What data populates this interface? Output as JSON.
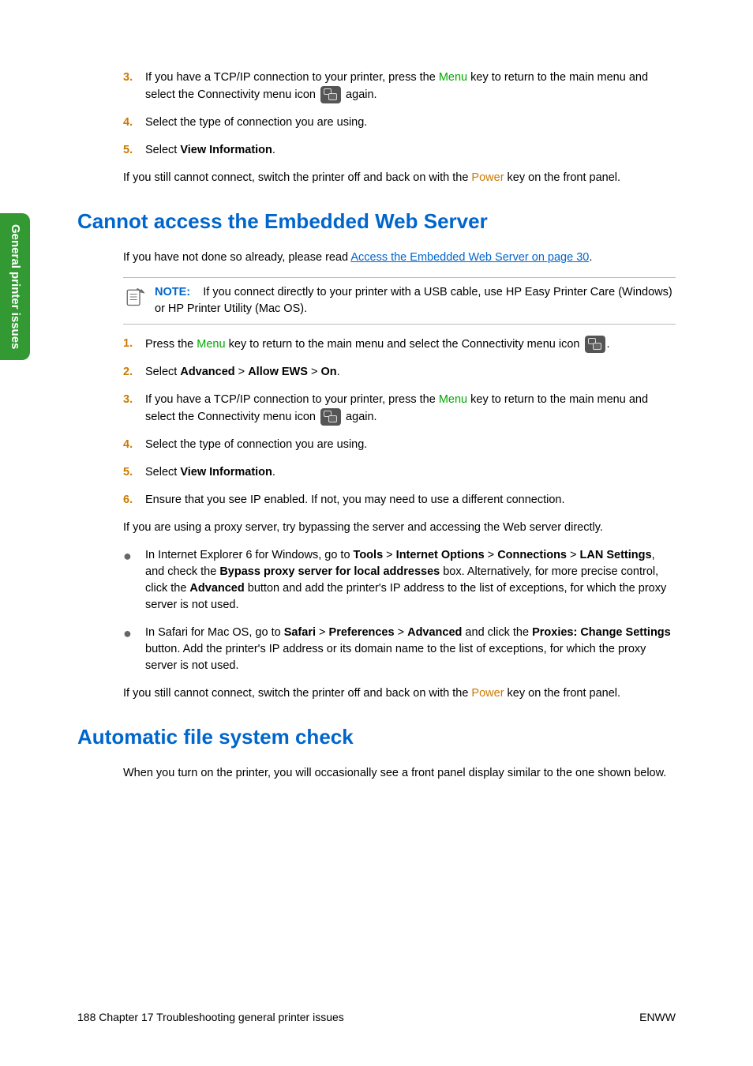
{
  "tab": {
    "label": "General printer issues"
  },
  "top_section": {
    "items": {
      "3": {
        "text1": "If you have a TCP/IP connection to your printer, press the ",
        "menu": "Menu",
        "text2": " key to return to the main menu and select the Connectivity menu icon ",
        "text3": " again."
      },
      "4": "Select the type of connection you are using.",
      "5_prefix": "Select ",
      "5_bold": "View Information",
      "5_suffix": "."
    },
    "after1": "If you still cannot connect, switch the printer off and back on with the ",
    "power": "Power",
    "after2": " key on the front panel."
  },
  "h2a": "Cannot access the Embedded Web Server",
  "ews": {
    "intro1": "If you have not done so already, please read ",
    "link": "Access the Embedded Web Server on page 30",
    "intro2": ".",
    "note_label": "NOTE:",
    "note_text": "If you connect directly to your printer with a USB cable, use HP Easy Printer Care (Windows) or HP Printer Utility (Mac OS).",
    "s1a": "Press the ",
    "menu": "Menu",
    "s1b": " key to return to the main menu and select the Connectivity menu icon ",
    "s1c": ".",
    "s2a": "Select ",
    "s2b": "Advanced",
    "s2c": "Allow EWS",
    "s2d": "On",
    "gt": " > ",
    "s2e": ".",
    "s3a": "If you have a TCP/IP connection to your printer, press the ",
    "s3b": " key to return to the main menu and select the Connectivity menu icon ",
    "s3c": " again.",
    "s4": "Select the type of connection you are using.",
    "s5a": "Select ",
    "s5b": "View Information",
    "s5c": ".",
    "s6": "Ensure that you see IP enabled. If not, you may need to use a different connection.",
    "proxy_intro": "If you are using a proxy server, try bypassing the server and accessing the Web server directly.",
    "b1a": "In Internet Explorer 6 for Windows, go to ",
    "b1_tools": "Tools",
    "b1_io": "Internet Options",
    "b1_conn": "Connections",
    "b1_lan": "LAN Settings",
    "b1b": ", and check the ",
    "b1_bypass": "Bypass proxy server for local addresses",
    "b1c": " box. Alternatively, for more precise control, click the ",
    "b1_adv": "Advanced",
    "b1d": " button and add the printer's IP address to the list of exceptions, for which the proxy server is not used.",
    "b2a": "In Safari for Mac OS, go to ",
    "b2_safari": "Safari",
    "b2_pref": "Preferences",
    "b2_adv": "Advanced",
    "b2b": " and click the ",
    "b2_prox": "Proxies: Change Settings",
    "b2c": " button. Add the printer's IP address or its domain name to the list of exceptions, for which the proxy server is not used.",
    "end1": "If you still cannot connect, switch the printer off and back on with the ",
    "end2": " key on the front panel.",
    "power": "Power"
  },
  "h2b": "Automatic file system check",
  "afs": {
    "p1": "When you turn on the printer, you will occasionally see a front panel display similar to the one shown below."
  },
  "footer": {
    "left": "188   Chapter 17   Troubleshooting general printer issues",
    "right": "ENWW"
  }
}
